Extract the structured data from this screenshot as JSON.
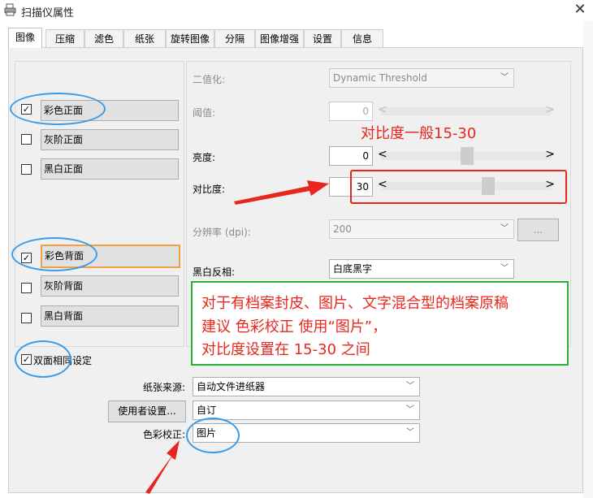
{
  "window": {
    "title": "扫描仪属性",
    "close_glyph": "✕"
  },
  "tabs": [
    {
      "label": "图像",
      "active": true
    },
    {
      "label": "压缩"
    },
    {
      "label": "滤色"
    },
    {
      "label": "纸张"
    },
    {
      "label": "旋转图像"
    },
    {
      "label": "分隔"
    },
    {
      "label": "图像增强"
    },
    {
      "label": "设置"
    },
    {
      "label": "信息"
    }
  ],
  "image_options": {
    "front": [
      {
        "label": "彩色正面",
        "checked": true,
        "check_glyph": "✓"
      },
      {
        "label": "灰阶正面",
        "checked": false
      },
      {
        "label": "黑白正面",
        "checked": false
      }
    ],
    "back": [
      {
        "label": "彩色背面",
        "checked": true,
        "check_glyph": "✓"
      },
      {
        "label": "灰阶背面",
        "checked": false
      },
      {
        "label": "黑白背面",
        "checked": false
      }
    ]
  },
  "settings": {
    "binarize": {
      "label": "二值化:",
      "value": "Dynamic Threshold"
    },
    "threshold": {
      "label": "阈值:",
      "value": "0"
    },
    "brightness": {
      "label": "亮度:",
      "value": "0"
    },
    "contrast": {
      "label": "对比度:",
      "value": "30"
    },
    "resolution": {
      "label": "分辨率 (dpi):",
      "value": "200",
      "button": "..."
    },
    "bw_invert": {
      "label": "黑白反相:",
      "value": "白底黑字"
    }
  },
  "duplex_same": {
    "label": "双面相同设定",
    "checked": true,
    "check_glyph": "✓"
  },
  "paper_source": {
    "label": "纸张来源:",
    "value": "自动文件进纸器"
  },
  "user_settings": {
    "button": "使用者设置...",
    "value": "自订"
  },
  "color_correction": {
    "label": "色彩校正:",
    "value": "图片"
  },
  "annotations": {
    "contrast_note": "对比度一般15-30",
    "advice_lines": [
      "对于有档案封皮、图片、文字混合型的档案原稿",
      "建议 色彩校正 使用“图片”，",
      "对比度设置在 15-30 之间"
    ],
    "colors": {
      "red": "#e8261c",
      "green": "#2cae3a",
      "blue": "#3a9be8"
    }
  },
  "glyphs": {
    "dropdown": "﹀",
    "left": "<",
    "right": ">"
  }
}
